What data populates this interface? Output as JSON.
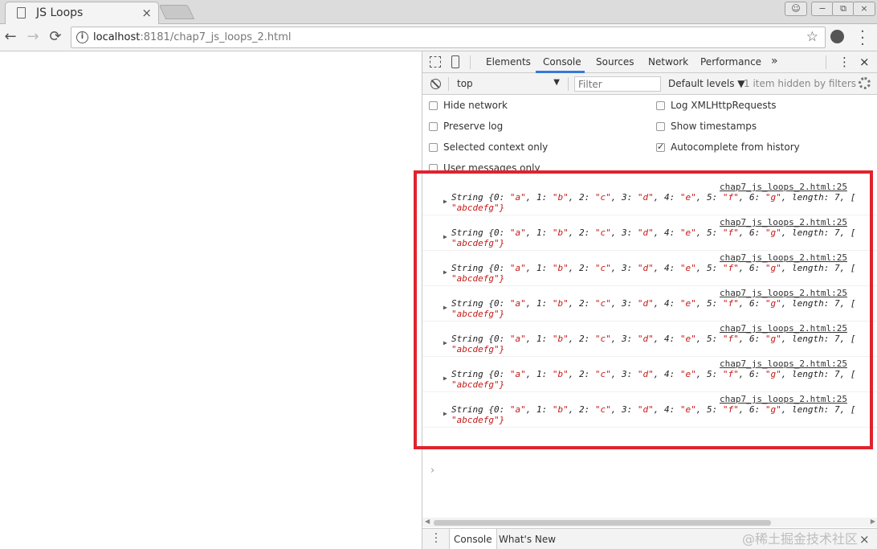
{
  "tab": {
    "title": "JS Loops",
    "close": "×"
  },
  "window": {
    "user": "☺",
    "minimize": "−",
    "restore": "⧉",
    "close": "×"
  },
  "toolbar": {
    "back": "←",
    "forward": "→",
    "reload": "⟳",
    "url_host": "localhost",
    "url_rest": ":8181/chap7_js_loops_2.html",
    "star": "☆"
  },
  "devtools": {
    "tabs": [
      "Elements",
      "Console",
      "Sources",
      "Network",
      "Performance"
    ],
    "more_tabs": "»",
    "menu": "⋮",
    "close": "×",
    "context": "top",
    "filter_placeholder": "Filter",
    "levels": "Default levels ▼",
    "hidden": "1 item hidden by filters",
    "settings": [
      {
        "label": "Hide network",
        "checked": false
      },
      {
        "label": "Log XMLHttpRequests",
        "checked": false
      },
      {
        "label": "Preserve log",
        "checked": false
      },
      {
        "label": "Show timestamps",
        "checked": false
      },
      {
        "label": "Selected context only",
        "checked": false
      },
      {
        "label": "Autocomplete from history",
        "checked": true
      },
      {
        "label": "User messages only",
        "checked": false
      }
    ],
    "messages": [
      {
        "source": "chap7_js_loops_2.html:25",
        "line1": "String {0: \"a\", 1: \"b\", 2: \"c\", 3: \"d\", 4: \"e\", 5: \"f\", 6: \"g\", length: 7, [",
        "line2": "\"abcdefg\"}"
      },
      {
        "source": "chap7_js_loops_2.html:25",
        "line1": "String {0: \"a\", 1: \"b\", 2: \"c\", 3: \"d\", 4: \"e\", 5: \"f\", 6: \"g\", length: 7, [",
        "line2": "\"abcdefg\"}"
      },
      {
        "source": "chap7_js_loops_2.html:25",
        "line1": "String {0: \"a\", 1: \"b\", 2: \"c\", 3: \"d\", 4: \"e\", 5: \"f\", 6: \"g\", length: 7, [",
        "line2": "\"abcdefg\"}"
      },
      {
        "source": "chap7_js_loops_2.html:25",
        "line1": "String {0: \"a\", 1: \"b\", 2: \"c\", 3: \"d\", 4: \"e\", 5: \"f\", 6: \"g\", length: 7, [",
        "line2": "\"abcdefg\"}"
      },
      {
        "source": "chap7_js_loops_2.html:25",
        "line1": "String {0: \"a\", 1: \"b\", 2: \"c\", 3: \"d\", 4: \"e\", 5: \"f\", 6: \"g\", length: 7, [",
        "line2": "\"abcdefg\"}"
      },
      {
        "source": "chap7_js_loops_2.html:25",
        "line1": "String {0: \"a\", 1: \"b\", 2: \"c\", 3: \"d\", 4: \"e\", 5: \"f\", 6: \"g\", length: 7, [",
        "line2": "\"abcdefg\"}"
      },
      {
        "source": "chap7_js_loops_2.html:25",
        "line1": "String {0: \"a\", 1: \"b\", 2: \"c\", 3: \"d\", 4: \"e\", 5: \"f\", 6: \"g\", length: 7, [",
        "line2": "\"abcdefg\"}"
      }
    ],
    "prompt": "›",
    "drawer_tabs": [
      "Console",
      "What's New"
    ],
    "drawer_close": "×"
  },
  "watermark": "@稀土掘金技术社区",
  "colors": {
    "highlight": "#e0232e",
    "string": "#c41a16",
    "active_tab": "#3879d9"
  }
}
